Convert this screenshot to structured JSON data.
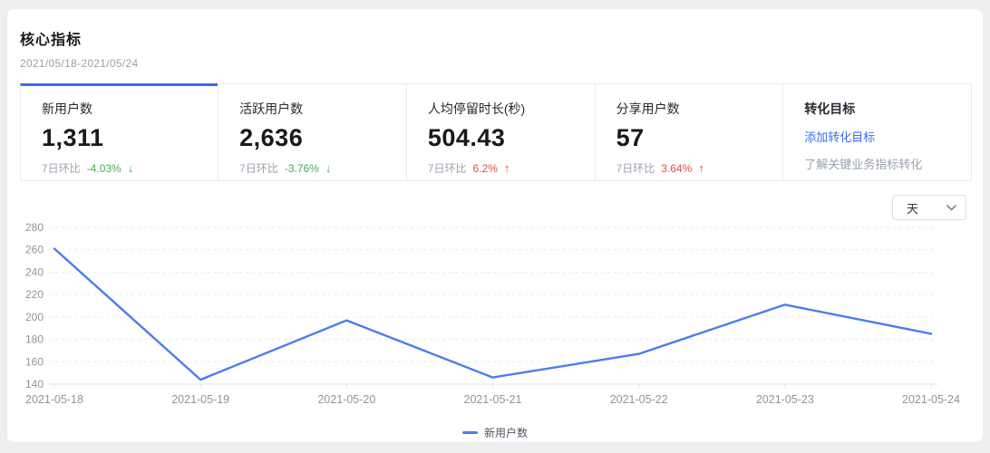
{
  "panel": {
    "title": "核心指标",
    "date_range": "2021/05/18-2021/05/24"
  },
  "metric_cards": [
    {
      "label": "新用户数",
      "value": "1,311",
      "compare_label": "7日环比",
      "change": "-4.03%",
      "direction": "down",
      "active": true
    },
    {
      "label": "活跃用户数",
      "value": "2,636",
      "compare_label": "7日环比",
      "change": "-3.76%",
      "direction": "down",
      "active": false
    },
    {
      "label": "人均停留时长(秒)",
      "value": "504.43",
      "compare_label": "7日环比",
      "change": "6.2%",
      "direction": "up",
      "active": false
    },
    {
      "label": "分享用户数",
      "value": "57",
      "compare_label": "7日环比",
      "change": "3.64%",
      "direction": "up",
      "active": false
    }
  ],
  "conversion_card": {
    "title": "转化目标",
    "link_label": "添加转化目标",
    "description": "了解关键业务指标转化"
  },
  "granularity_select": {
    "value": "天"
  },
  "icons": {
    "arrow_down": "↓",
    "arrow_up": "↑",
    "chevron_down": "chevron-down"
  },
  "chart_data": {
    "type": "line",
    "x": [
      "2021-05-18",
      "2021-05-19",
      "2021-05-20",
      "2021-05-21",
      "2021-05-22",
      "2021-05-23",
      "2021-05-24"
    ],
    "series": [
      {
        "name": "新用户数",
        "values": [
          261,
          144,
          197,
          146,
          167,
          211,
          185
        ],
        "color": "#4a7df0"
      }
    ],
    "ylim": [
      140,
      280
    ],
    "y_ticks": [
      140,
      160,
      180,
      200,
      220,
      240,
      260,
      280
    ],
    "grid": "horizontal-dashed",
    "legend_position": "bottom-center"
  },
  "colors": {
    "accent_blue": "#3b6cf0",
    "line_blue": "#4a7df0",
    "positive_red": "#f0483e",
    "negative_green": "#43b14b",
    "panel_bg": "#ffffff",
    "page_bg": "#eceef0",
    "grid_line": "#e7eaee",
    "axis_line": "#dfe3e8",
    "axis_label": "#8f959e"
  }
}
